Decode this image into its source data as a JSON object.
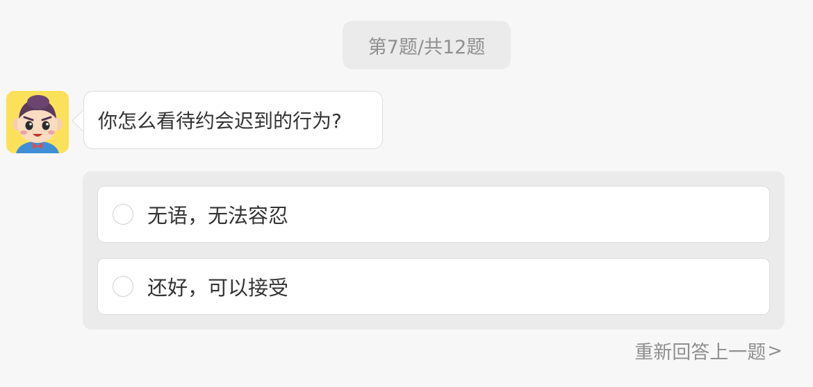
{
  "quiz": {
    "progress": "第7题/共12题",
    "question": "你怎么看待约会迟到的行为?",
    "options": [
      {
        "label": "无语，无法容忍"
      },
      {
        "label": "还好，可以接受"
      }
    ],
    "redo_label": "重新回答上一题",
    "redo_chevron": ">"
  },
  "colors": {
    "background": "#f7f7f7",
    "avatar_bg": "#fbe15a",
    "panel_bg": "#ebebeb",
    "muted_text": "#8f8f8f",
    "main_text": "#333333"
  },
  "icons": {
    "avatar": "cartoon-boy-avatar",
    "redo": "chevron-right-icon",
    "option_marker": "radio-circle"
  }
}
